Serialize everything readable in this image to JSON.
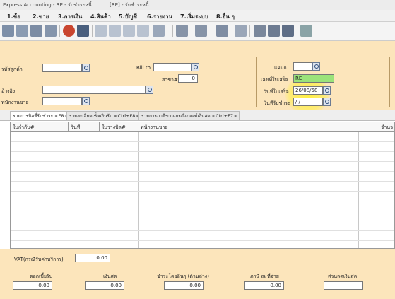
{
  "window": {
    "title_left": "Express Accounting - RE - รับชำระหนี้",
    "title_mid": "[RE] - รับชำระหนี้"
  },
  "menu": [
    {
      "label": "1.ข้อ"
    },
    {
      "label": "2.ขาย"
    },
    {
      "label": "3.การเงิน"
    },
    {
      "label": "4.สินค้า"
    },
    {
      "label": "5.บัญชี"
    },
    {
      "label": "6.รายงาน"
    },
    {
      "label": "7.เริ่มระบบ"
    },
    {
      "label": "8.อื่น ๆ"
    }
  ],
  "header": {
    "customer_code_label": "รหัสลูกค้า",
    "customer_code_value": "",
    "bill_to_label": "Bill to",
    "bill_to_value": "",
    "branch_label": "สาขา#",
    "branch_value": "0",
    "reference_label": "อ้างอิง",
    "reference_value": "",
    "salesperson_label": "พนักงานขาย",
    "salesperson_value": "",
    "department_label": "แผนก",
    "department_value": "",
    "receipt_no_label": "เลขที่ใบเสร็จ",
    "receipt_no_value": "RE",
    "receipt_date_label": "วันที่ใบเสร็จ",
    "receipt_date_value": "26/08/58",
    "payment_date_label": "วันที่รับชำระ",
    "payment_date_value": " / /"
  },
  "tabs": [
    {
      "label": "รายการบิลที่รับชำระ <F8>"
    },
    {
      "label": "รายละเอียดเช็คเงินรับ <Ctrl+F8>"
    },
    {
      "label": "รายการภาษีขาย-กรณีเกณฑ์เงินสด <Ctrl+F7>"
    }
  ],
  "grid": {
    "columns": [
      {
        "label": "ใบกำกับ#"
      },
      {
        "label": "วันที่"
      },
      {
        "label": "ใบวางบิล#"
      },
      {
        "label": "พนักงานขาย"
      },
      {
        "label": "จำนว"
      }
    ]
  },
  "footer": {
    "vat_label": "VAT(กรณีรับค่าบริการ)",
    "vat_value": "0.00",
    "fields": [
      {
        "label": "ดอกเบี้ยรับ",
        "value": "0.00"
      },
      {
        "label": "เงินสด",
        "value": "0.00"
      },
      {
        "label": "ชำระโดยอื่นๆ (ด้านล่าง)",
        "value": "0.00"
      },
      {
        "label": "ภาษี ณ ที่จ่าย",
        "value": "0.00"
      },
      {
        "label": "ส่วนลดเงินสด",
        "value": ""
      }
    ]
  },
  "colors": {
    "panel": "#fce5bb",
    "highlight": "#fff028",
    "receipt_no_bg": "#9be37a"
  }
}
